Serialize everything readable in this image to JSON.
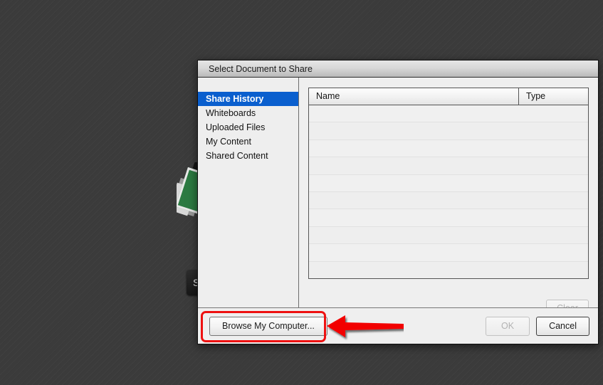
{
  "dialog": {
    "title": "Select Document to Share",
    "sidebar": {
      "items": [
        {
          "label": "Share History",
          "selected": true
        },
        {
          "label": "Whiteboards",
          "selected": false
        },
        {
          "label": "Uploaded Files",
          "selected": false
        },
        {
          "label": "My Content",
          "selected": false
        },
        {
          "label": "Shared Content",
          "selected": false
        }
      ]
    },
    "table": {
      "columns": [
        "Name",
        "Type"
      ],
      "rows": [],
      "empty_row_count": 10
    },
    "clear_button": {
      "label": "Clear",
      "enabled": false
    },
    "footer": {
      "browse_button": {
        "label": "Browse My Computer...",
        "enabled": true
      },
      "ok_button": {
        "label": "OK",
        "enabled": false
      },
      "cancel_button": {
        "label": "Cancel",
        "enabled": true
      }
    }
  },
  "background": {
    "partial_button_label": "S"
  },
  "annotations": {
    "highlight_color": "#ee1111",
    "arrow_color": "#f20505",
    "arrow_direction": "left",
    "target": "Browse My Computer..."
  },
  "colors": {
    "selection_blue": "#0a5fce",
    "dialog_bg": "#efefef",
    "desktop_bg": "#3b3b3b"
  }
}
